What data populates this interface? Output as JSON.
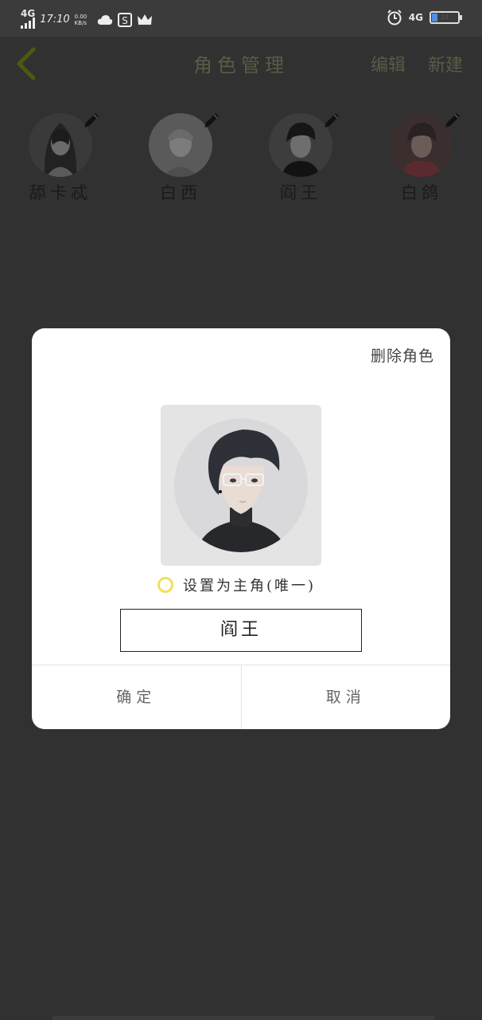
{
  "status_bar": {
    "network_left": "4G",
    "time": "17:10",
    "speed": "0.00 KB/s",
    "network_right": "4G",
    "battery_level": "24"
  },
  "header": {
    "title": "角色管理",
    "edit_label": "编辑",
    "new_label": "新建"
  },
  "roles": [
    {
      "name": "舔卡忒",
      "avatar": "sketch-girl-avatar"
    },
    {
      "name": "白西",
      "avatar": "pale-boy-avatar"
    },
    {
      "name": "阎王",
      "avatar": "glasses-boy-avatar"
    },
    {
      "name": "白鸽",
      "avatar": "red-boy-avatar"
    }
  ],
  "dialog": {
    "delete_label": "删除角色",
    "set_main_label": "设置为主角(唯一)",
    "name_value": "阎王",
    "confirm_label": "确定",
    "cancel_label": "取消"
  },
  "colors": {
    "background": "#303130",
    "header_text": "#5b5b48",
    "radio_ring": "#f0e05a",
    "dialog_bg": "#ffffff"
  }
}
